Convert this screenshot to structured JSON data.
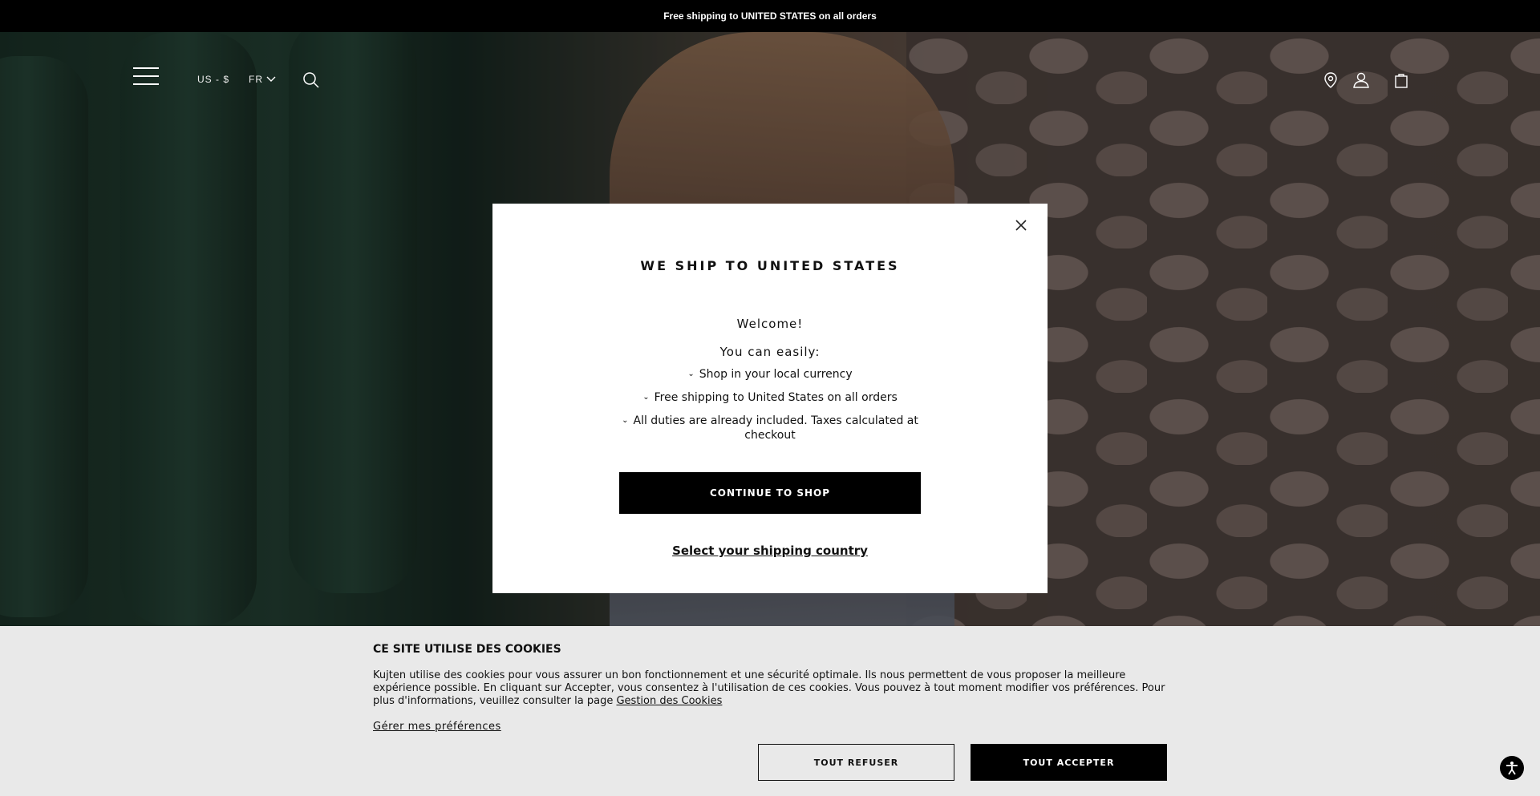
{
  "announcement": {
    "text": "Free shipping to UNITED STATES on all orders"
  },
  "header": {
    "currency": "US - $",
    "language": "FR",
    "icons": [
      "menu-icon",
      "chevron-down-icon",
      "search-icon",
      "location-pin-icon",
      "user-icon",
      "shopping-bag-icon"
    ]
  },
  "modal": {
    "title": "WE SHIP TO UNITED STATES",
    "welcome": "Welcome!",
    "intro": "You can easily:",
    "benefits": [
      "Shop in your local currency",
      "Free shipping to United States on all orders",
      "All duties are already included. Taxes calculated at checkout"
    ],
    "continue_label": "CONTINUE TO SHOP",
    "select_country_label": "Select your shipping country"
  },
  "cookies": {
    "title": "CE SITE UTILISE DES COOKIES",
    "body": "Kujten utilise des cookies pour vous assurer un bon fonctionnement et une sécurité optimale. Ils nous permettent de vous proposer la meilleure expérience possible. En cliquant sur Accepter, vous consentez à l'utilisation de ces cookies. Vous pouvez à tout moment modifier vos préférences. Pour plus d'informations, veuillez consulter la page",
    "link_label": "Gestion des Cookies",
    "prefs_label": "Gérer mes préférences",
    "refuse_label": "TOUT REFUSER",
    "accept_label": "TOUT ACCEPTER"
  },
  "colors": {
    "bar": "#000000",
    "modal_bg": "#ffffff",
    "cookie_bg": "#e9e9e9",
    "button_dark": "#000000"
  }
}
